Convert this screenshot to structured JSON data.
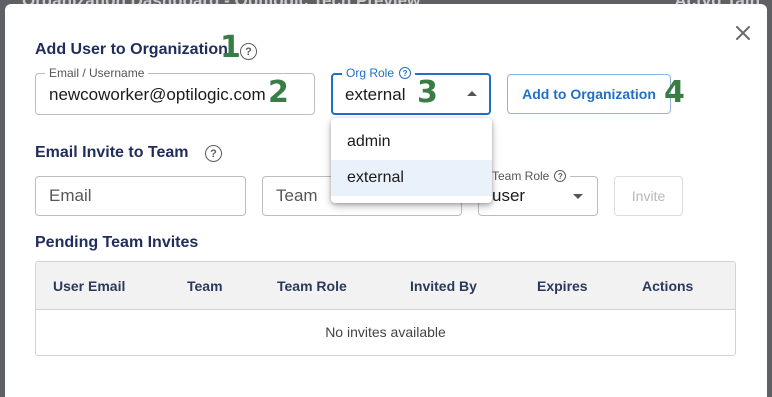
{
  "backdrop": {
    "left_text": "Organization Dashboard - Optilogic Tech Preview",
    "right_text": "Actvd Tain"
  },
  "modal": {
    "close_icon": "close-icon",
    "add_user": {
      "title": "Add User to Organization",
      "email_label": "Email / Username",
      "email_value": "newcoworker@optilogic.com",
      "role_label": "Org Role",
      "role_value": "external",
      "role_options": [
        "admin",
        "external"
      ],
      "add_button": "Add to Organization"
    },
    "email_invite": {
      "title": "Email Invite to Team",
      "email_placeholder": "Email",
      "team_placeholder": "Team",
      "team_role_label": "Team Role",
      "team_role_value": "user",
      "invite_button": "Invite"
    },
    "pending": {
      "title": "Pending Team Invites",
      "columns": [
        "User Email",
        "Team",
        "Team Role",
        "Invited By",
        "Expires",
        "Actions"
      ],
      "empty_message": "No invites available"
    }
  },
  "annotations": [
    "1",
    "2",
    "3",
    "4"
  ],
  "colors": {
    "accent": "#1e70c8",
    "title": "#1f2d5c",
    "annotation": "#3a7d44"
  }
}
